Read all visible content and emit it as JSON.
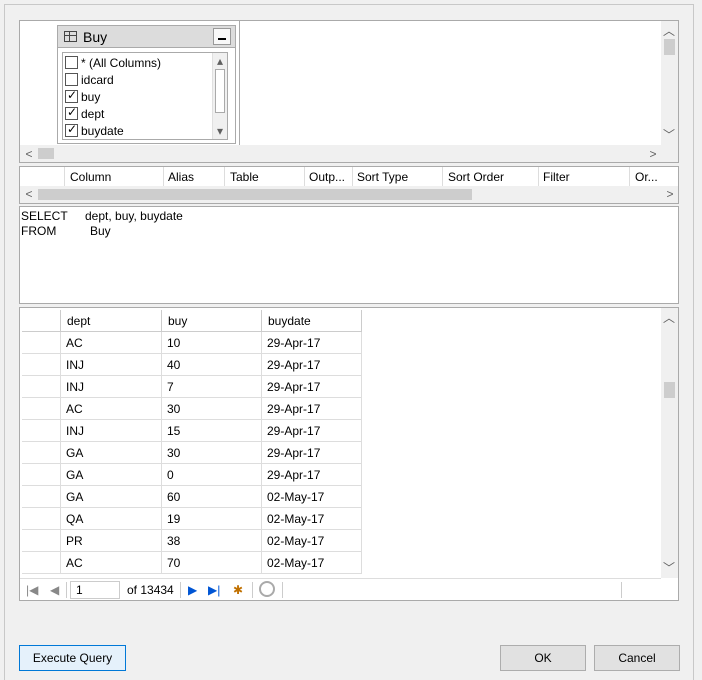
{
  "diagram": {
    "table_name": "Buy",
    "columns": [
      {
        "label": "* (All Columns)",
        "checked": false
      },
      {
        "label": "idcard",
        "checked": false
      },
      {
        "label": "buy",
        "checked": true
      },
      {
        "label": "dept",
        "checked": true
      },
      {
        "label": "buydate",
        "checked": true
      }
    ]
  },
  "criteria": {
    "headers": [
      "Column",
      "Alias",
      "Table",
      "Outp...",
      "Sort Type",
      "Sort Order",
      "Filter",
      "Or..."
    ]
  },
  "sql": {
    "line1_keyword": "SELECT",
    "line1_value": "dept, buy, buydate",
    "line2_keyword": "FROM",
    "line2_value": "Buy"
  },
  "results": {
    "headers": [
      "dept",
      "buy",
      "buydate"
    ],
    "rows": [
      [
        "AC",
        "10",
        "29-Apr-17"
      ],
      [
        "INJ",
        "40",
        "29-Apr-17"
      ],
      [
        "INJ",
        "7",
        "29-Apr-17"
      ],
      [
        "AC",
        "30",
        "29-Apr-17"
      ],
      [
        "INJ",
        "15",
        "29-Apr-17"
      ],
      [
        "GA",
        "30",
        "29-Apr-17"
      ],
      [
        "GA",
        "0",
        "29-Apr-17"
      ],
      [
        "GA",
        "60",
        "02-May-17"
      ],
      [
        "QA",
        "19",
        "02-May-17"
      ],
      [
        "PR",
        "38",
        "02-May-17"
      ],
      [
        "AC",
        "70",
        "02-May-17"
      ]
    ],
    "nav": {
      "page": "1",
      "of_label": "of 13434"
    }
  },
  "buttons": {
    "execute": "Execute Query",
    "ok": "OK",
    "cancel": "Cancel"
  },
  "icons": {
    "first": "first-page-icon",
    "prev": "previous-page-icon",
    "next": "next-page-icon",
    "last": "last-page-icon",
    "new": "new-row-icon",
    "stop": "stop-icon"
  }
}
